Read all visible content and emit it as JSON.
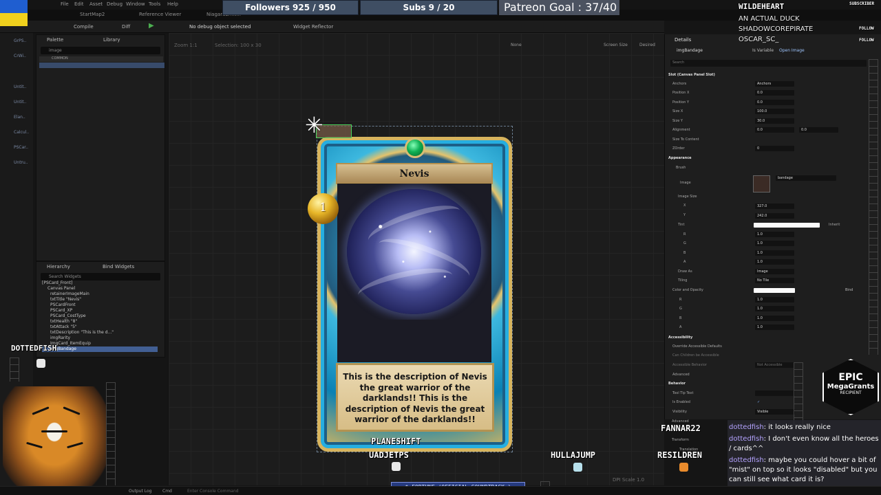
{
  "menu": {
    "items": [
      "File",
      "Edit",
      "Asset",
      "Debug",
      "Window",
      "Tools",
      "Help"
    ],
    "tabs": [
      "StartMap2",
      "Reference Viewer",
      "NiagaraEmit..."
    ]
  },
  "toolbar": {
    "compile": "Compile",
    "diff": "Diff",
    "debug_select": "No debug object selected",
    "widget_reflector": "Widget Reflector"
  },
  "left_rail": [
    "GrPS..",
    "CrWi..",
    "Untit..",
    "Untit..",
    "Elan..",
    "Calcul..",
    "PSCar..",
    "Untru.."
  ],
  "palette": {
    "tab_palette": "Palette",
    "tab_library": "Library",
    "search": "image",
    "common": "COMMON"
  },
  "hierarchy": {
    "tab_hierarchy": "Hierarchy",
    "tab_bind": "Bind Widgets",
    "search_placeholder": "Search Widgets",
    "items": [
      "[PSCard_Front]",
      "Canvas Panel",
      "retainerImageMain",
      "txtTitle \"Nevis\"",
      "PSCardFront",
      "PSCard_XP",
      "PSCard_CostType",
      "txtHealth \"8\"",
      "txtAttack \"5\"",
      "txtDescription \"This is the d...\"",
      "imgRarity",
      "ImgCard_ItemEquip",
      "imgBandage"
    ],
    "selected_index": 12
  },
  "canvas": {
    "zoom": "Zoom 1:1",
    "selection": "Selection: 100 x 30",
    "tools_none": "None",
    "screen_size": "Screen Size",
    "desired": "Desired",
    "dpi_scale": "DPI Scale 1.0"
  },
  "card": {
    "title": "Nevis",
    "cost": "1",
    "description": "This is the description of Nevis the great warrior of the darklands!! This is the description of Nevis the great warrior of the darklands!!"
  },
  "details": {
    "tab": "Details",
    "widget_name": "imgBandage",
    "is_variable": "Is Variable",
    "open_image": "Open Image",
    "search": "Search",
    "slot": "Slot (Canvas Panel Slot)",
    "anchors_label": "Anchors",
    "anchors_value": "Anchors",
    "position_x": "Position X",
    "position_x_value": "0.0",
    "position_y": "Position Y",
    "position_y_value": "0.0",
    "size_x": "Size X",
    "size_x_value": "100.0",
    "size_y": "Size Y",
    "size_y_value": "30.0",
    "alignment": "Alignment",
    "alignment_x": "0.0",
    "alignment_y": "0.0",
    "size_to_content": "Size To Content",
    "zorder": "ZOrder",
    "zorder_value": "0",
    "appearance": "Appearance",
    "brush": "Brush",
    "image": "Image",
    "bandage": "bandage",
    "image_size": "Image Size",
    "image_x": "X",
    "image_x_value": "327.0",
    "image_y": "Y",
    "image_y_value": "242.0",
    "tint": "Tint",
    "inherit": "Inherit",
    "r": "R",
    "r_value": "1.0",
    "g": "G",
    "g_value": "1.0",
    "b": "B",
    "b_value": "1.0",
    "a": "A",
    "a_value": "1.0",
    "draw_as": "Draw As",
    "draw_as_value": "Image",
    "tiling": "Tiling",
    "tiling_value": "No Tile",
    "color_opacity": "Color and Opacity",
    "color_r": "1.0",
    "color_g": "1.0",
    "color_b": "1.0",
    "color_a": "1.0",
    "accessibility": "Accessibility",
    "override_accessible": "Override Accessible Defaults",
    "children_accessible": "Can Children be Accessible",
    "accessible_behavior": "Accessible Behavior",
    "not_accessible": "Not Accessible",
    "advanced": "Advanced",
    "behavior": "Behavior",
    "tooltip": "Tool Tip Text",
    "is_enabled": "Is Enabled",
    "visibility": "Visibility",
    "visibility_value": "Visible",
    "advanced_2": "Advanced",
    "transform": "Transform",
    "translation": "Translation",
    "bind": "Bind"
  },
  "stream": {
    "followers": "Followers 925 / 950",
    "subs": "Subs 9 / 20",
    "patreon": "Patreon Goal : 37/40",
    "top_name": "WILDEHEART",
    "subscriber": "SUBSCRIBER",
    "follow_1": "FOLLOW",
    "follow_2": "FOLLOW",
    "subscriber_small": "SUBSCRIBER",
    "recent_1": "AN ACTUAL DUCK",
    "recent_2": "SHADOWCOREPIRATE",
    "recent_3": "OSCAR_SC_",
    "dottedfish": "DOTTEDFISH",
    "planeshift": "PLANESHIFT",
    "uadjetps": "UADJETPS",
    "hullajump": "HULLAJUMP",
    "resildren": "RESILDREN",
    "fannar": "FANNAR22",
    "epic_line_1": "EPIC",
    "epic_line_2": "MegaGrants",
    "epic_line_3": "RECIPIENT",
    "fortune": "$ FORTUNE (OFFICIAL SOUNDTRACK )"
  },
  "chat": [
    {
      "user": "dottedfish",
      "text": ": it looks really nice"
    },
    {
      "user": "dottedfish",
      "text": ": I don't even know all the heroes / cards^^"
    },
    {
      "user": "dottedfish",
      "text": ": maybe you could hover a bit of \"mist\" on top so it looks \"disabled\" but you can still see what card it is?"
    }
  ],
  "bottom": {
    "output_log": "Output Log",
    "cmd": "Cmd",
    "console": "Enter Console Command"
  },
  "colors": {
    "accent_blue": "#425f93",
    "card_gold": "#d7b45e",
    "card_cyan": "#26aee0",
    "selection_green": "#4bd85d"
  }
}
